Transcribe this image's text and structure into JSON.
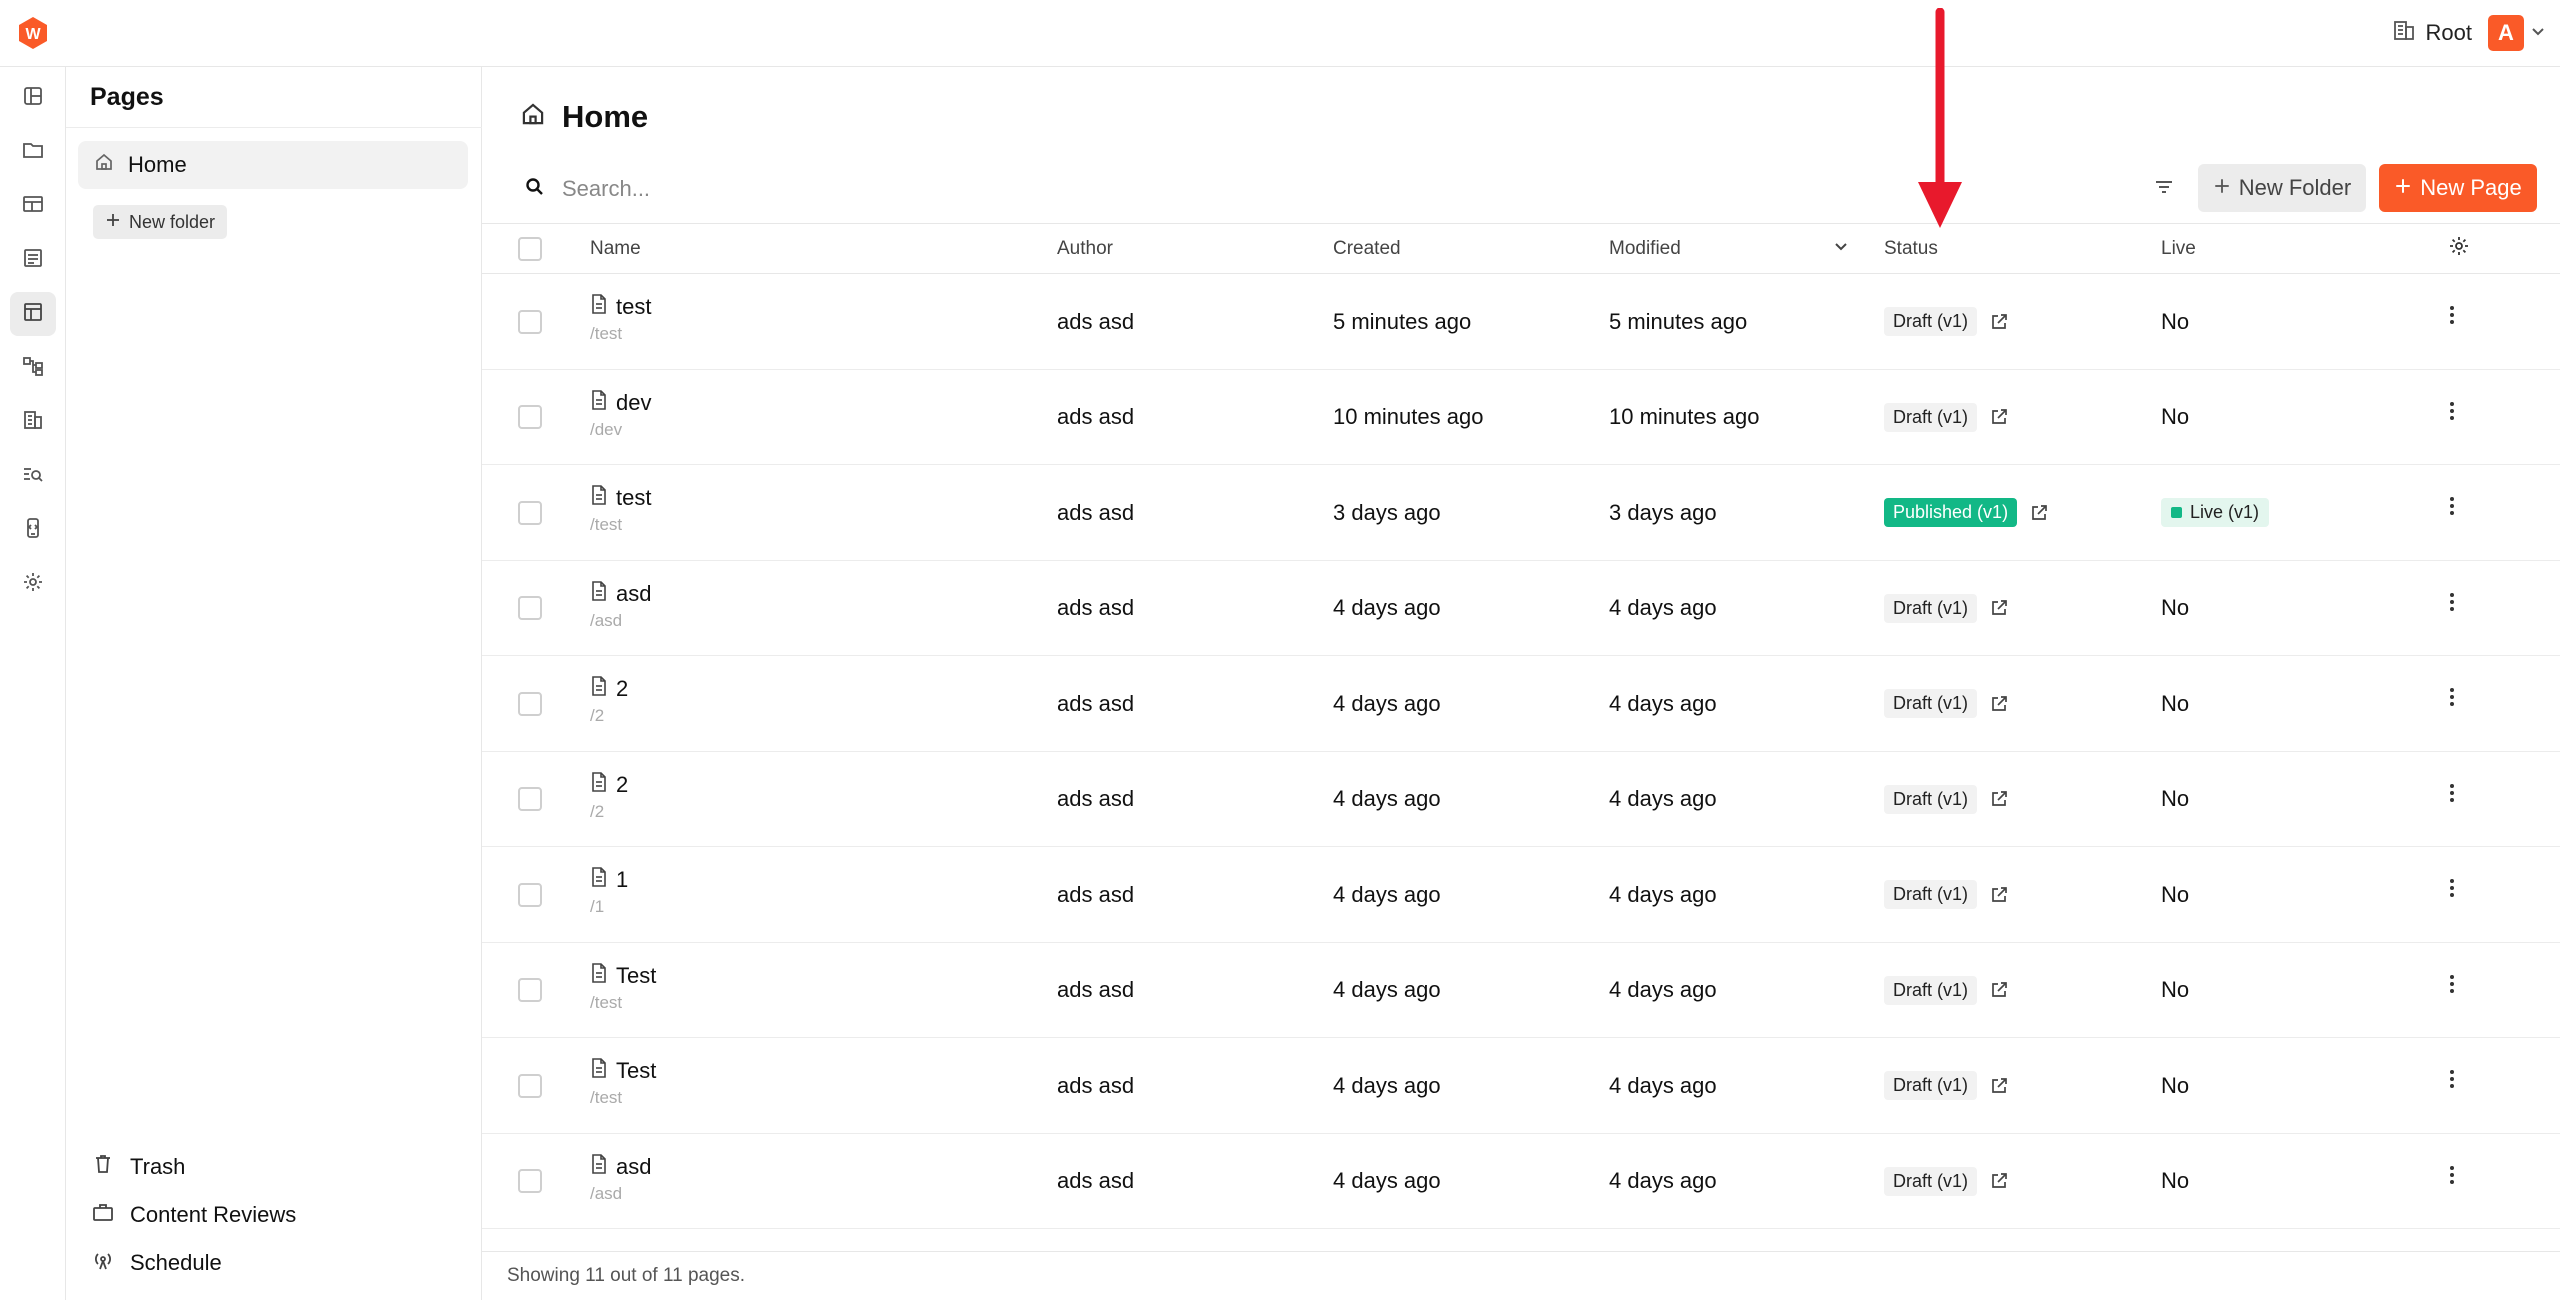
{
  "topbar": {
    "tenant": "Root",
    "avatar_initial": "A"
  },
  "sidebar": {
    "title": "Pages",
    "tree_home": "Home",
    "new_folder": "New folder",
    "bottom": {
      "trash": "Trash",
      "content_reviews": "Content Reviews",
      "schedule": "Schedule"
    }
  },
  "main": {
    "title": "Home",
    "search_placeholder": "Search...",
    "new_folder_button": "New Folder",
    "new_page_button": "New Page",
    "columns": {
      "name": "Name",
      "author": "Author",
      "created": "Created",
      "modified": "Modified",
      "status": "Status",
      "live": "Live"
    },
    "rows": [
      {
        "name": "test",
        "slug": "/test",
        "author": "ads asd",
        "created": "5 minutes ago",
        "modified": "5 minutes ago",
        "status": "Draft (v1)",
        "status_type": "draft",
        "live": "No"
      },
      {
        "name": "dev",
        "slug": "/dev",
        "author": "ads asd",
        "created": "10 minutes ago",
        "modified": "10 minutes ago",
        "status": "Draft (v1)",
        "status_type": "draft",
        "live": "No"
      },
      {
        "name": "test",
        "slug": "/test",
        "author": "ads asd",
        "created": "3 days ago",
        "modified": "3 days ago",
        "status": "Published (v1)",
        "status_type": "published",
        "live": "Live (v1)"
      },
      {
        "name": "asd",
        "slug": "/asd",
        "author": "ads asd",
        "created": "4 days ago",
        "modified": "4 days ago",
        "status": "Draft (v1)",
        "status_type": "draft",
        "live": "No"
      },
      {
        "name": "2",
        "slug": "/2",
        "author": "ads asd",
        "created": "4 days ago",
        "modified": "4 days ago",
        "status": "Draft (v1)",
        "status_type": "draft",
        "live": "No"
      },
      {
        "name": "2",
        "slug": "/2",
        "author": "ads asd",
        "created": "4 days ago",
        "modified": "4 days ago",
        "status": "Draft (v1)",
        "status_type": "draft",
        "live": "No"
      },
      {
        "name": "1",
        "slug": "/1",
        "author": "ads asd",
        "created": "4 days ago",
        "modified": "4 days ago",
        "status": "Draft (v1)",
        "status_type": "draft",
        "live": "No"
      },
      {
        "name": "Test",
        "slug": "/test",
        "author": "ads asd",
        "created": "4 days ago",
        "modified": "4 days ago",
        "status": "Draft (v1)",
        "status_type": "draft",
        "live": "No"
      },
      {
        "name": "Test",
        "slug": "/test",
        "author": "ads asd",
        "created": "4 days ago",
        "modified": "4 days ago",
        "status": "Draft (v1)",
        "status_type": "draft",
        "live": "No"
      },
      {
        "name": "asd",
        "slug": "/asd",
        "author": "ads asd",
        "created": "4 days ago",
        "modified": "4 days ago",
        "status": "Draft (v1)",
        "status_type": "draft",
        "live": "No"
      }
    ],
    "footer": "Showing 11 out of 11 pages."
  },
  "icons": {
    "rail": [
      "dashboard-icon",
      "folder-icon",
      "layout-icon",
      "form-icon",
      "table-icon",
      "workflow-icon",
      "building-icon",
      "search-list-icon",
      "device-icon",
      "gear-icon"
    ]
  },
  "colors": {
    "brand": "#fa5a28",
    "published": "#12b886",
    "arrow": "#e8192c"
  }
}
